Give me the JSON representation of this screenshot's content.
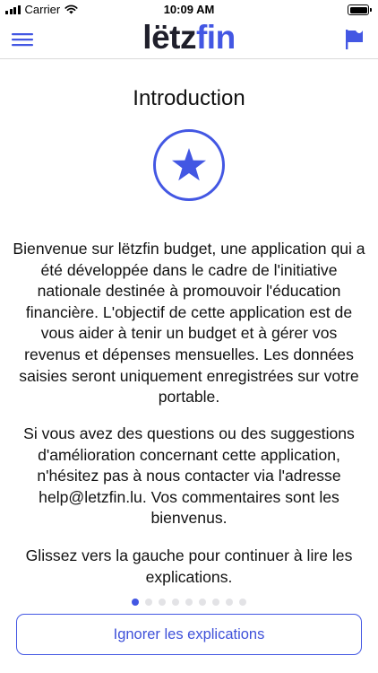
{
  "status_bar": {
    "carrier": "Carrier",
    "time": "10:09 AM"
  },
  "header": {
    "logo_part1": "lëtz",
    "logo_part2": "fin",
    "icons": {
      "menu": "hamburger-menu-icon",
      "flag": "flag-icon"
    }
  },
  "main": {
    "title": "Introduction",
    "badge_icon": "star-icon",
    "paragraphs": [
      "Bienvenue sur lëtzfin budget, une application qui a été développée dans le cadre de l'initiative nationale destinée à promouvoir l'éducation financière. L'objectif de cette application est de vous aider à tenir un budget et à gérer vos revenus et dépenses mensuelles. Les données saisies seront uniquement enregistrées sur votre portable.",
      "Si vous avez des questions ou des suggestions d'amélioration concernant cette application, n'hésitez pas à nous contacter via l'adresse help@letzfin.lu. Vos commentaires sont les bienvenus.",
      "Glissez vers la gauche pour continuer à lire les explications."
    ]
  },
  "pager": {
    "total_pages": 9,
    "current_page": 1
  },
  "footer": {
    "skip_label": "Ignorer les explications"
  },
  "colors": {
    "accent": "#4357e3",
    "logo_dark": "#1f1f2b"
  }
}
